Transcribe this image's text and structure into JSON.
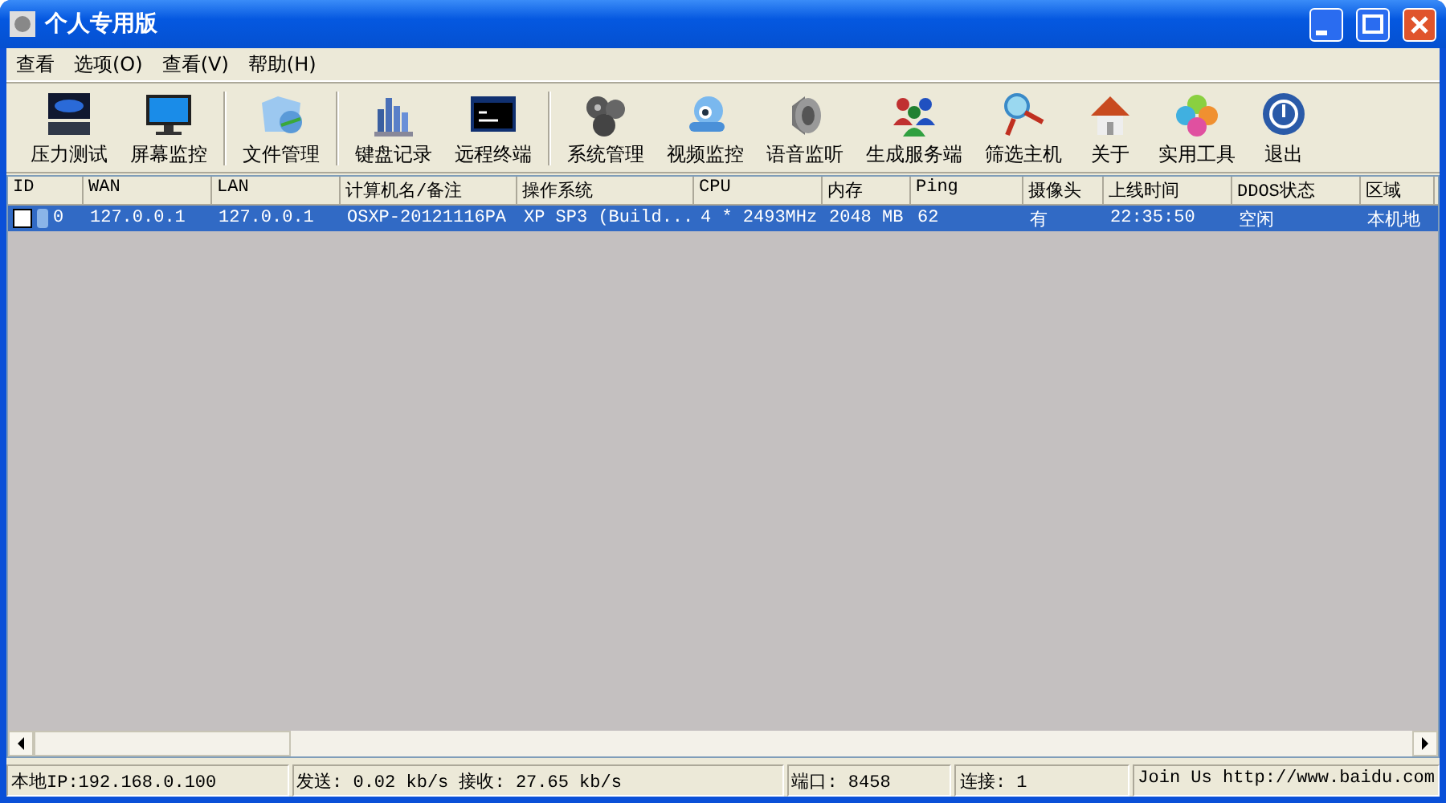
{
  "window": {
    "title": "个人专用版"
  },
  "menu": [
    "查看",
    "选项(O)",
    "查看(V)",
    "帮助(H)"
  ],
  "toolbar": [
    {
      "label": "压力测试",
      "kind": "ddos",
      "sep": false
    },
    {
      "label": "屏幕监控",
      "kind": "monitor",
      "sep": true
    },
    {
      "label": "文件管理",
      "kind": "folder",
      "sep": true
    },
    {
      "label": "键盘记录",
      "kind": "chart",
      "sep": false
    },
    {
      "label": "远程终端",
      "kind": "terminal",
      "sep": true
    },
    {
      "label": "系统管理",
      "kind": "gears",
      "sep": false
    },
    {
      "label": "视频监控",
      "kind": "webcam",
      "sep": false
    },
    {
      "label": "语音监听",
      "kind": "speaker",
      "sep": false
    },
    {
      "label": "生成服务端",
      "kind": "people",
      "sep": false
    },
    {
      "label": "筛选主机",
      "kind": "magnifier",
      "sep": false
    },
    {
      "label": "关于",
      "kind": "house",
      "sep": false
    },
    {
      "label": "实用工具",
      "kind": "clover",
      "sep": false
    },
    {
      "label": "退出",
      "kind": "power",
      "sep": false
    }
  ],
  "table": {
    "columns": [
      "ID",
      "WAN",
      "LAN",
      "计算机名/备注",
      "操作系统",
      "CPU",
      "内存",
      "Ping",
      "摄像头",
      "上线时间",
      "DDOS状态",
      "区域"
    ],
    "rows": [
      {
        "selected": true,
        "checked": false,
        "cells": [
          "0",
          "127.0.0.1",
          "127.0.0.1",
          "OSXP-20121116PA",
          "XP SP3 (Build...",
          "4 * 2493MHz",
          "2048 MB",
          "62",
          "有",
          "22:35:50",
          "空闲",
          "本机地"
        ]
      }
    ]
  },
  "status_bar": [
    "本地IP:192.168.0.100",
    "发送: 0.02 kb/s 接收: 27.65 kb/s",
    "端口: 8458",
    "连接: 1",
    "Join Us http://www.baidu.com"
  ]
}
